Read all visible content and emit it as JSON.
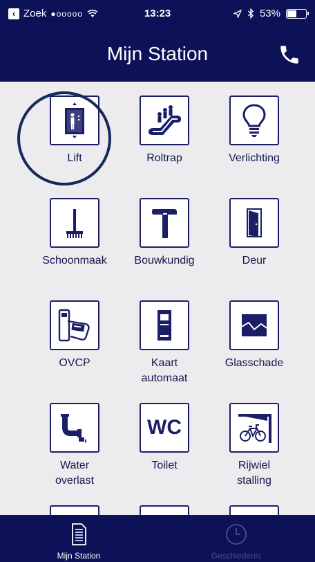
{
  "status_bar": {
    "back_label": "Zoek",
    "signal": "●ooooo",
    "time": "13:23",
    "battery": "53%",
    "battery_level": 0.53
  },
  "header": {
    "title": "Mijn Station"
  },
  "tiles": [
    {
      "label": "Lift"
    },
    {
      "label": "Roltrap"
    },
    {
      "label": "Verlichting"
    },
    {
      "label": "Schoonmaak"
    },
    {
      "label": "Bouwkundig"
    },
    {
      "label": "Deur"
    },
    {
      "label": "OVCP"
    },
    {
      "label": "Kaart\nautomaat"
    },
    {
      "label": "Glasschade"
    },
    {
      "label": "Water\noverlast"
    },
    {
      "label": "Toilet"
    },
    {
      "label": "Rijwiel\nstalling"
    }
  ],
  "tab_bar": {
    "tabs": [
      {
        "label": "Mijn Station",
        "active": true
      },
      {
        "label": "Geschiedenis",
        "active": false
      }
    ]
  },
  "colors": {
    "brand": "#0d1158",
    "icon": "#1a1e67",
    "inactive_tab": "#4a4f86"
  },
  "toilet_icon_text": "WC"
}
